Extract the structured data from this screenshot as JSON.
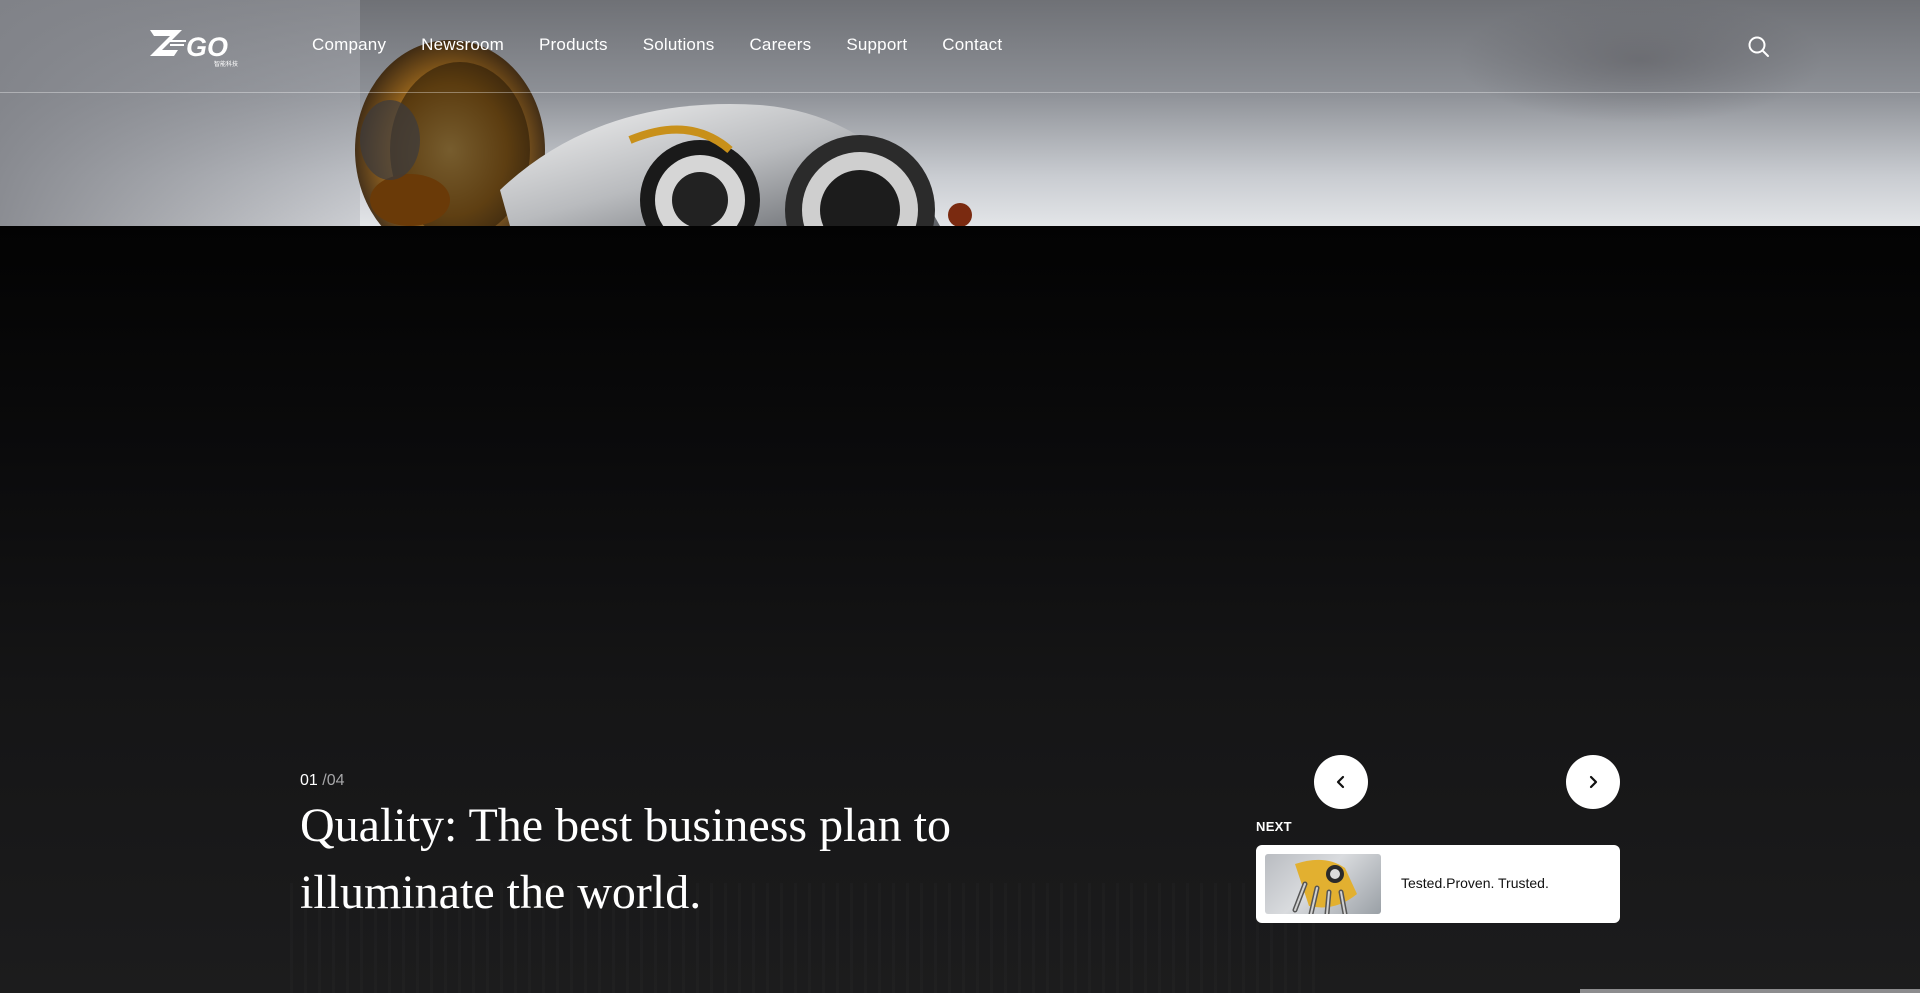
{
  "brand": {
    "logo_text": "GO",
    "logo_subtext": "智能科技"
  },
  "nav": {
    "items": [
      "Company",
      "Newsroom",
      "Products",
      "Solutions",
      "Careers",
      "Support",
      "Contact"
    ]
  },
  "header": {
    "search_icon": "search-icon"
  },
  "slide": {
    "current": "01",
    "total": "/04",
    "headline": "Quality: The best business plan to illuminate the world."
  },
  "controls": {
    "prev_icon": "chevron-left-icon",
    "next_icon": "chevron-right-icon"
  },
  "next_preview": {
    "label": "NEXT",
    "title": "Tested.Proven. Trusted."
  },
  "colors": {
    "accent": "#ffffff",
    "background": "#000000",
    "card": "#ffffff"
  }
}
